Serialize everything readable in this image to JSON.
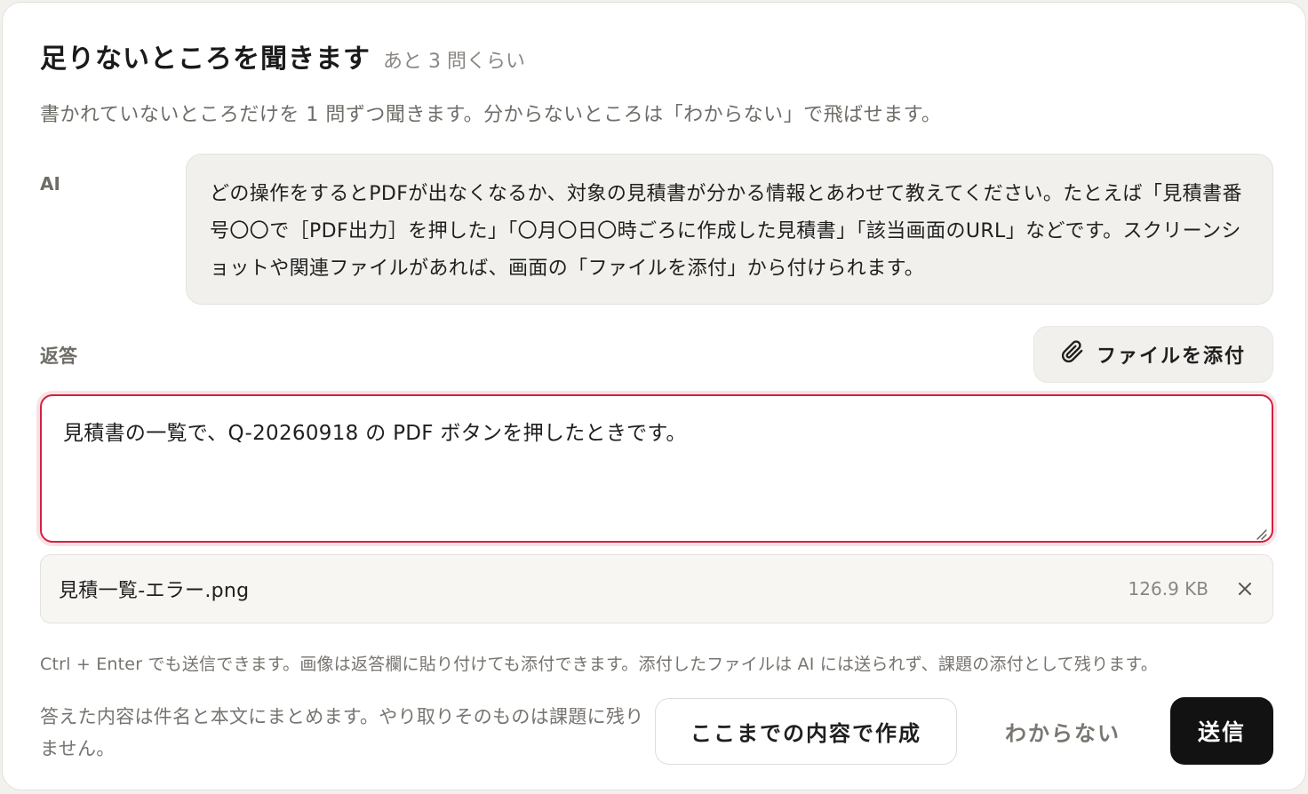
{
  "header": {
    "title": "足りないところを聞きます",
    "remaining": "あと 3 問くらい",
    "description": "書かれていないところだけを 1 問ずつ聞きます。分からないところは「わからない」で飛ばせます。"
  },
  "ai": {
    "label": "AI",
    "message": "どの操作をするとPDFが出なくなるか、対象の見積書が分かる情報とあわせて教えてください。たとえば「見積書番号〇〇で［PDF出力］を押した」「〇月〇日〇時ごろに作成した見積書」「該当画面のURL」などです。スクリーンショットや関連ファイルがあれば、画面の「ファイルを添付」から付けられます。"
  },
  "reply": {
    "label": "返答",
    "attach_label": "ファイルを添付",
    "value": "見積書の一覧で、Q-20260918 の PDF ボタンを押したときです。"
  },
  "attachment": {
    "name": "見積一覧-エラー.png",
    "size": "126.9 KB"
  },
  "hint": "Ctrl + Enter でも送信できます。画像は返答欄に貼り付けても添付できます。添付したファイルは AI には送られず、課題の添付として残ります。",
  "footer": {
    "note": "答えた内容は件名と本文にまとめます。やり取りそのものは課題に残りません。",
    "create_label": "ここまでの内容で作成",
    "unknown_label": "わからない",
    "send_label": "送信"
  },
  "colors": {
    "accent_focus": "#d4203e",
    "primary_button": "#121212",
    "bubble_bg": "#f1f0ec"
  },
  "icons": {
    "attach": "paperclip-icon",
    "remove": "close-icon"
  }
}
